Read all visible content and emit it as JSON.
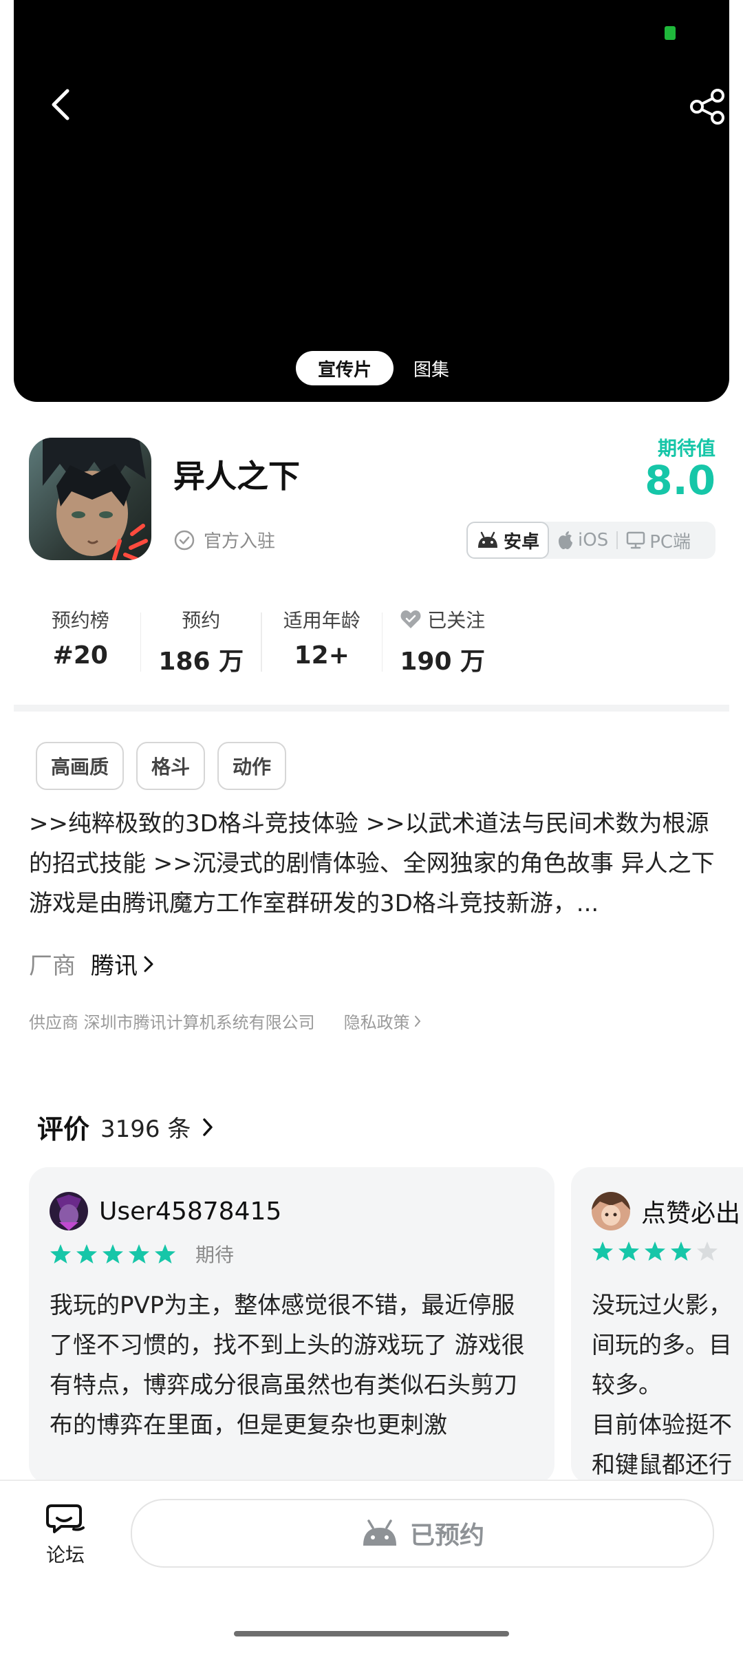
{
  "media": {
    "tabs": [
      {
        "label": "宣传片",
        "active": true
      },
      {
        "label": "图集",
        "active": false
      }
    ]
  },
  "game": {
    "title": "异人之下",
    "official_label": "官方入驻",
    "expect_label": "期待值",
    "expect_value": "8.0",
    "platforms": [
      {
        "label": "安卓",
        "icon": "android-icon",
        "active": true
      },
      {
        "label": "iOS",
        "icon": "apple-icon",
        "active": false
      },
      {
        "label": "PC端",
        "icon": "monitor-icon",
        "active": false
      }
    ]
  },
  "stats": [
    {
      "label": "预约榜",
      "value": "#20"
    },
    {
      "label": "预约",
      "value": "186 万"
    },
    {
      "label": "适用年龄",
      "value": "12+"
    },
    {
      "label": "已关注",
      "value": "190 万",
      "icon": "heart-icon"
    }
  ],
  "tags": [
    "高画质",
    "格斗",
    "动作"
  ],
  "description": ">>纯粹极致的3D格斗竞技体验 >>以武术道法与民间术数为根源的招式技能 >>沉浸式的剧情体验、全网独家的角色故事 异人之下游戏是由腾讯魔方工作室群研发的3D格斗竞技新游，...",
  "vendor": {
    "key": "厂商",
    "value": "腾讯"
  },
  "supplier": {
    "text": "供应商 深圳市腾讯计算机系统有限公司",
    "privacy": "隐私政策"
  },
  "reviews": {
    "title": "评价",
    "count": "3196 条",
    "items": [
      {
        "user": "User45878415",
        "stars": 5,
        "rating_label": "期待",
        "text": "我玩的PVP为主，整体感觉很不错，最近停服了怪不习惯的，找不到上头的游戏玩了 游戏很有特点，博弈成分很高虽然也有类似石头剪刀布的博弈在里面，但是更复杂也更刺激"
      },
      {
        "user": "点赞必出",
        "stars": 4,
        "rating_label": "",
        "lines": [
          "没玩过火影，",
          "间玩的多。目",
          "较多。",
          "目前体验挺不",
          "和键鼠都还行"
        ]
      }
    ]
  },
  "bottom": {
    "forum_label": "论坛",
    "reserve_label": "已预约"
  },
  "colors": {
    "accent": "#16c6a8",
    "star": "#16c6a8",
    "star_empty": "#d9dcde"
  }
}
